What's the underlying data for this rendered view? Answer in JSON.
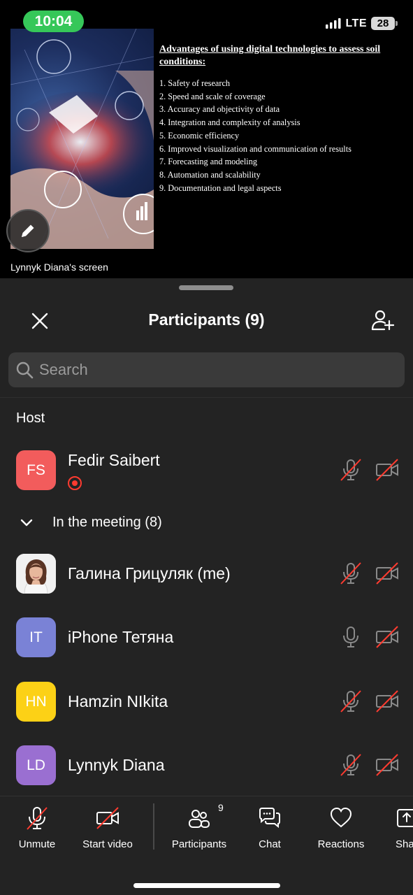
{
  "status_bar": {
    "time": "10:04",
    "network": "LTE",
    "battery": "28"
  },
  "shared_screen": {
    "slide_title": "Advantages of using digital technologies to assess soil conditions:",
    "items": [
      "1. Safety of research",
      "2. Speed and scale of coverage",
      "3. Accuracy and objectivity of data",
      "4. Integration and complexity of analysis",
      "5. Economic efficiency",
      "6. Improved visualization and communication of results",
      "7. Forecasting and modeling",
      "8. Automation and scalability",
      "9. Documentation and legal aspects"
    ],
    "label": "Lynnyk Diana's screen"
  },
  "sheet": {
    "title": "Participants (9)",
    "search_placeholder": "Search",
    "host_section": "Host",
    "group_label": "In the meeting (8)"
  },
  "host": {
    "initials": "FS",
    "name": "Fedir Saibert",
    "color": "#f25c5c",
    "mic": "muted",
    "video": "off"
  },
  "participants": [
    {
      "initials": "",
      "name": "Галина Грицуляк (me)",
      "color": "#ffffff",
      "mic": "muted",
      "video": "off",
      "photo": true
    },
    {
      "initials": "IT",
      "name": "iPhone Тетяна",
      "color": "#7a82d6",
      "mic": "on",
      "video": "off"
    },
    {
      "initials": "HN",
      "name": "Hamzin NIkita",
      "color": "#fcd116",
      "mic": "muted",
      "video": "off"
    },
    {
      "initials": "LD",
      "name": "Lynnyk Diana",
      "color": "#9a6fd1",
      "mic": "muted",
      "video": "off"
    }
  ],
  "toolbar": {
    "unmute": "Unmute",
    "start_video": "Start video",
    "participants": "Participants",
    "participants_count": "9",
    "chat": "Chat",
    "reactions": "Reactions",
    "share": "Share"
  },
  "colors": {
    "muted_slash": "#ff3b30",
    "accent_green": "#36c759"
  }
}
